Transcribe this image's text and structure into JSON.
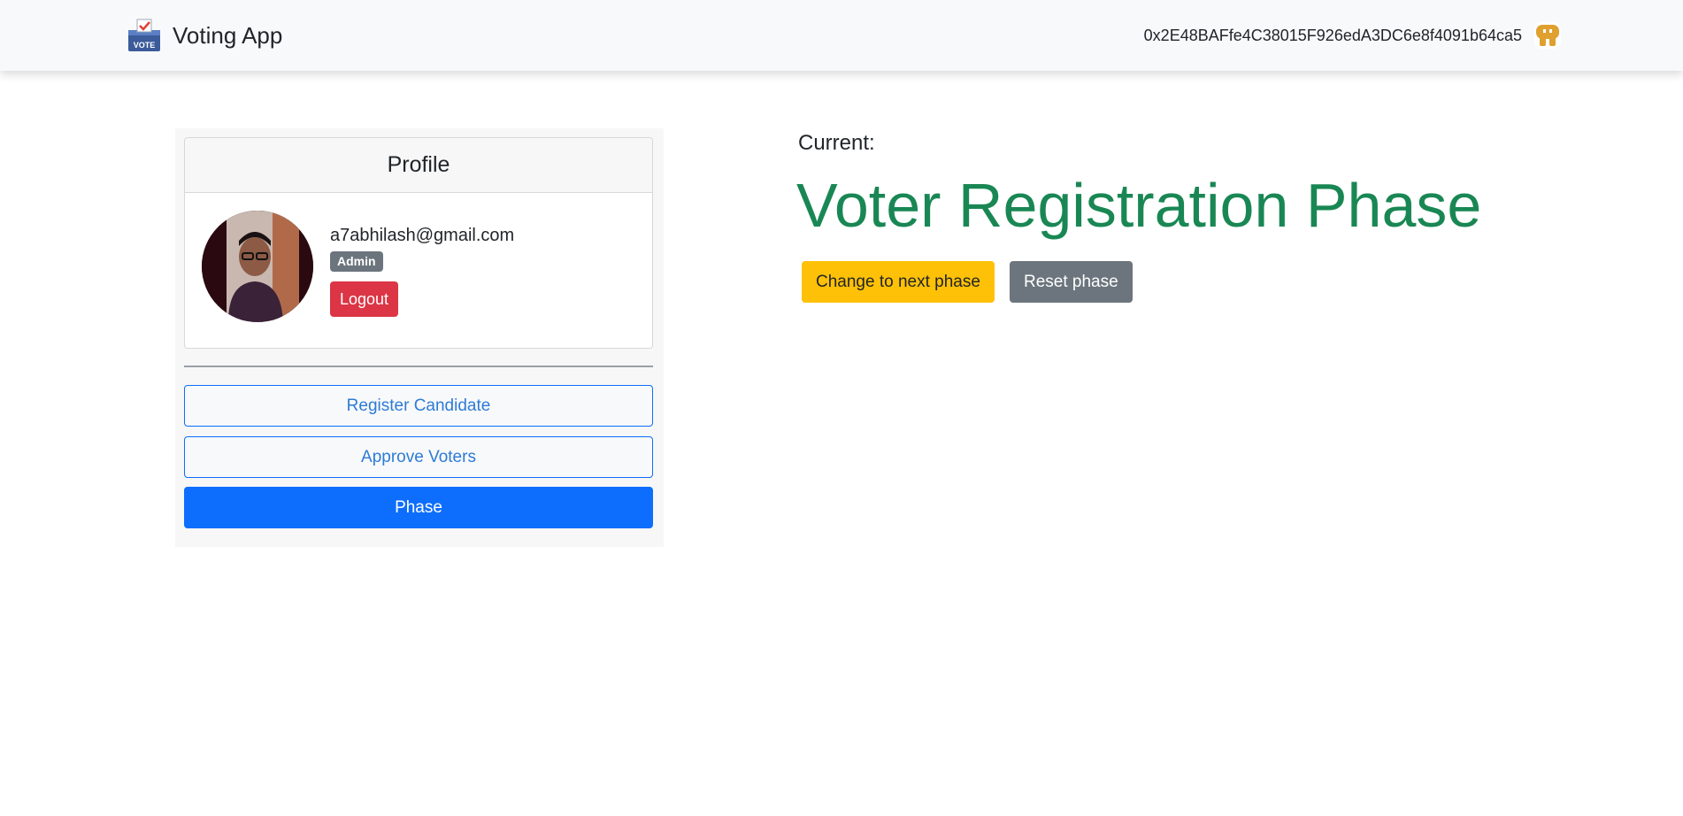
{
  "navbar": {
    "brand": "Voting App",
    "brand_icon": "ballot-box-vote-icon",
    "account_address": "0x2E48BAFfe4C38015F926edA3DC6e8f4091b64ca5",
    "account_icon": "identicon-avatar-icon"
  },
  "profile": {
    "header": "Profile",
    "email": "a7abhilash@gmail.com",
    "role": "Admin",
    "logout_label": "Logout"
  },
  "sidebar": {
    "items": [
      {
        "label": "Register Candidate",
        "active": false
      },
      {
        "label": "Approve Voters",
        "active": false
      },
      {
        "label": "Phase",
        "active": true
      }
    ]
  },
  "main": {
    "current_label": "Current:",
    "phase_name": "Voter Registration Phase",
    "next_label": "Change to next phase",
    "reset_label": "Reset phase"
  },
  "colors": {
    "primary": "#0d6efd",
    "success": "#198754",
    "warning": "#ffc107",
    "danger": "#dc3545",
    "secondary": "#6c757d"
  }
}
